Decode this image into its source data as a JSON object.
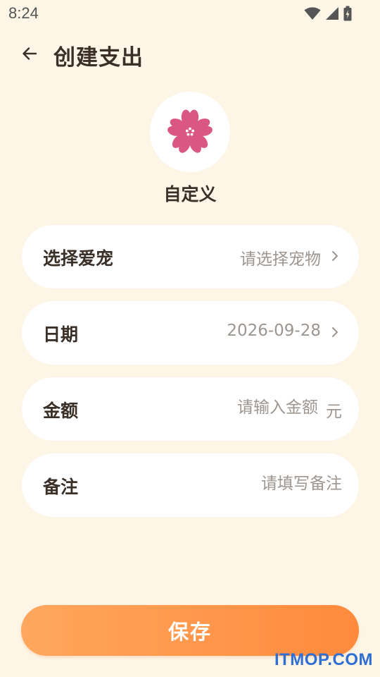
{
  "status_bar": {
    "time": "8:24",
    "icons": [
      "wifi-icon",
      "cellular-signal-icon",
      "battery-charging-icon"
    ]
  },
  "header": {
    "back_icon": "arrow-left-icon",
    "title": "创建支出"
  },
  "category": {
    "icon": "sakura-flower-icon",
    "icon_color": "#d95782",
    "name": "自定义"
  },
  "form": {
    "pet": {
      "label": "选择爱宠",
      "value": "请选择宠物"
    },
    "date": {
      "label": "日期",
      "value": "2026-09-28"
    },
    "amount": {
      "label": "金额",
      "placeholder": "请输入金额",
      "unit": "元"
    },
    "note": {
      "label": "备注",
      "placeholder": "请填写备注"
    }
  },
  "save_button": {
    "label": "保存"
  },
  "watermark": "ITMOP.COM",
  "colors": {
    "background": "#fdf6e7",
    "card": "#ffffff",
    "accent_start": "#ffa75e",
    "accent_end": "#ff8a3c",
    "text": "#3a3028",
    "hint": "#9d9690",
    "watermark": "#2f6fd3"
  }
}
